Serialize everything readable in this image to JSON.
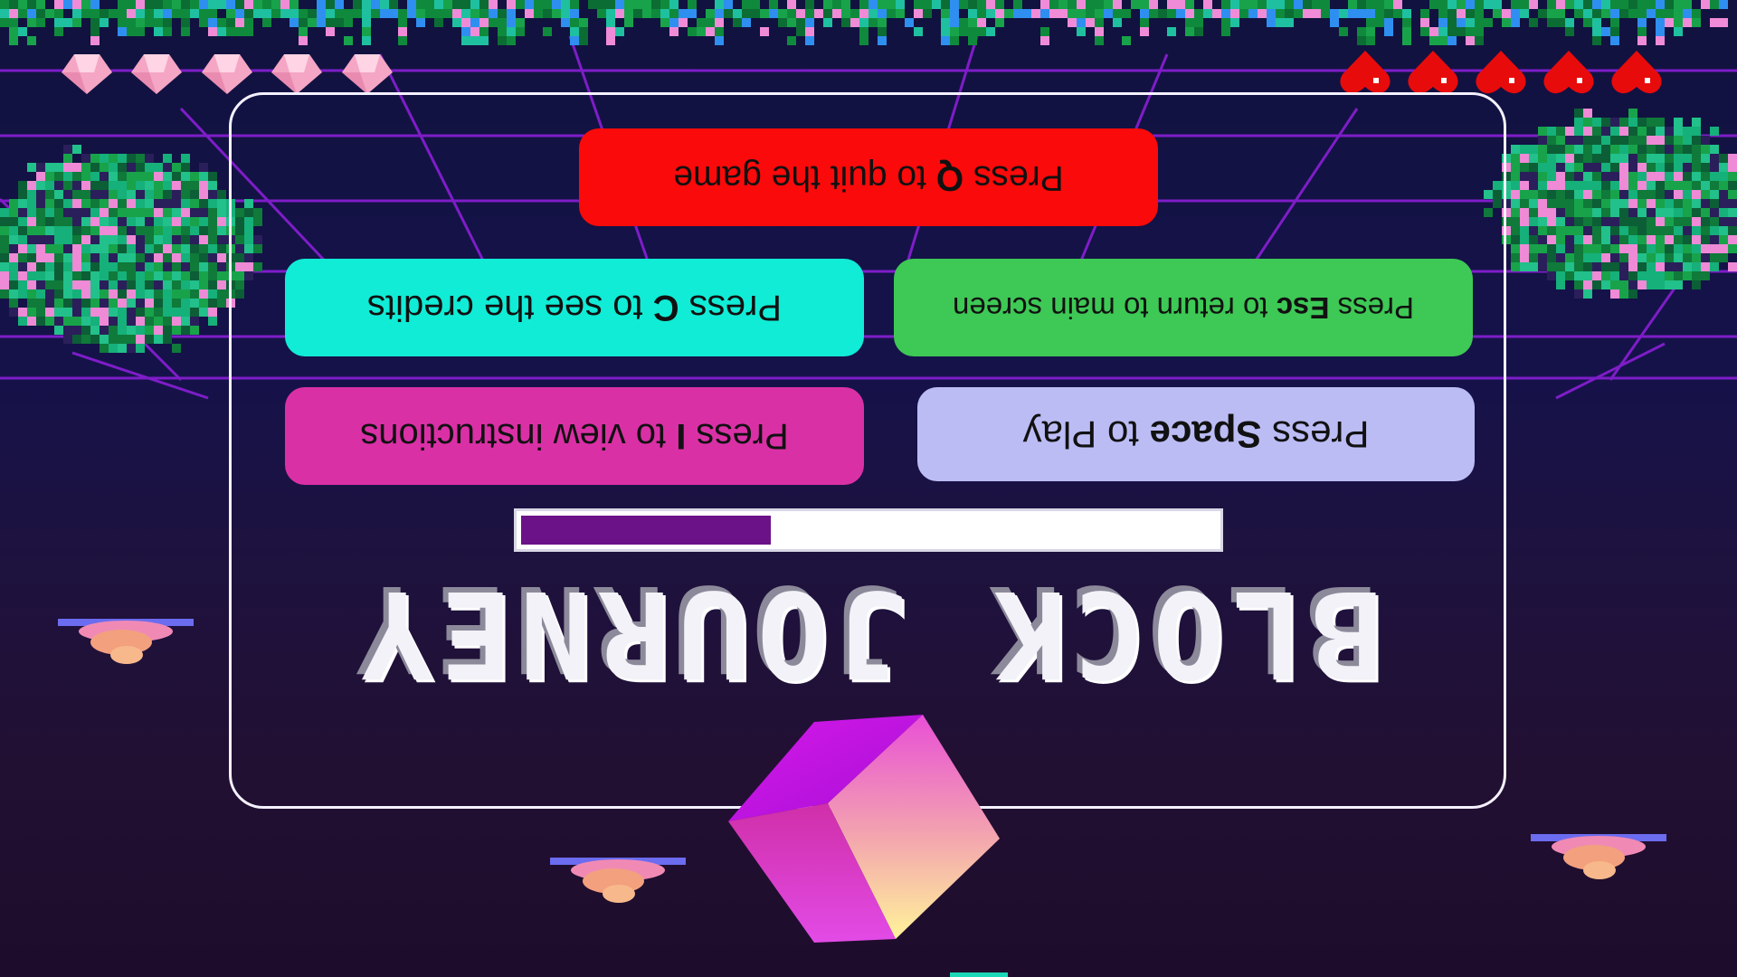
{
  "game": {
    "title": "BLOCK JOURNEY",
    "progress": 0.36
  },
  "hud": {
    "gems": 5,
    "hearts": 5
  },
  "menu": {
    "quit": {
      "pre": "Press ",
      "key": "Q",
      "post": " to quit the game"
    },
    "credits": {
      "pre": "Press ",
      "key": "C",
      "post": " to see the credits"
    },
    "esc": {
      "pre": "Press ",
      "key": "Esc",
      "post": " to return to main screen"
    },
    "instructions": {
      "pre": "Press ",
      "key": "I",
      "post": " to view instructions"
    },
    "play": {
      "pre": "Press ",
      "key": "Space",
      "post": " to Play"
    }
  },
  "colors": {
    "quit": "#fa0a0a",
    "credits": "#10ecd6",
    "esc": "#3ec855",
    "instructions": "#da30a6",
    "play": "#bcbcf5",
    "progress_fill": "#6b1289",
    "grid": "#8a1fd6"
  },
  "icons": [
    "gem-icon",
    "heart-icon",
    "cloud-icon",
    "cube-icon",
    "bush-icon"
  ]
}
